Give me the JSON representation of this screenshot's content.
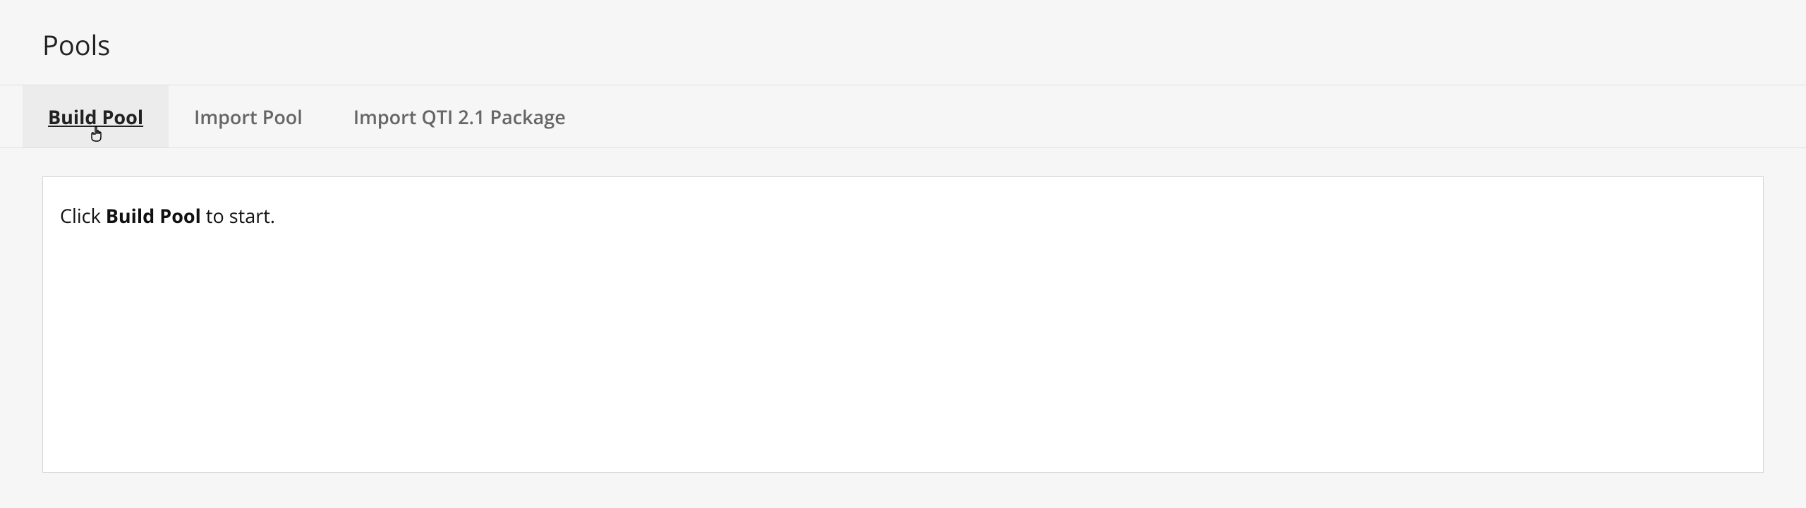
{
  "header": {
    "title": "Pools"
  },
  "toolbar": {
    "items": [
      {
        "label": "Build Pool",
        "active": true
      },
      {
        "label": "Import Pool",
        "active": false
      },
      {
        "label": "Import QTI 2.1 Package",
        "active": false
      }
    ]
  },
  "content": {
    "instruction_prefix": "Click ",
    "instruction_bold": "Build Pool",
    "instruction_suffix": " to start."
  }
}
